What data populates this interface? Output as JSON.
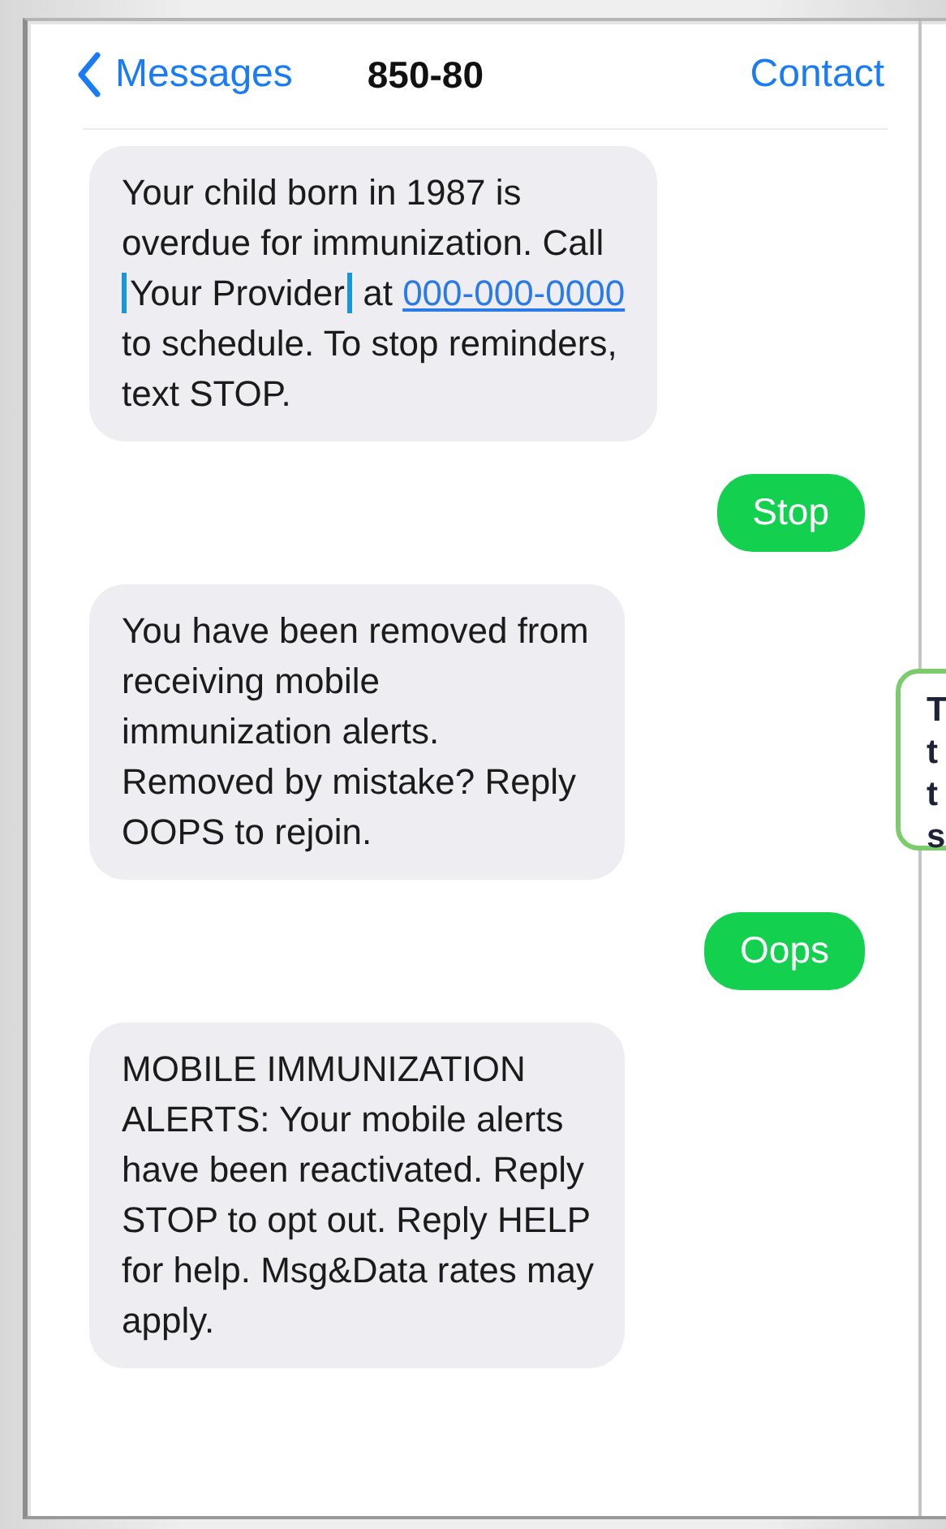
{
  "header": {
    "back_label": "Messages",
    "title": "850-80",
    "action": "Contact"
  },
  "messages": [
    {
      "kind": "incoming",
      "parts": [
        {
          "kind": "text",
          "text": "Your child born in 1987 is overdue for immunization. Call "
        },
        {
          "kind": "bracket",
          "text": "Your Provider"
        },
        {
          "kind": "text",
          "text": " at "
        },
        {
          "kind": "link",
          "text": "000-000-0000"
        },
        {
          "kind": "text",
          "text": " to schedule. To stop reminders, text STOP."
        }
      ]
    },
    {
      "kind": "outgoing",
      "parts": [
        {
          "kind": "text",
          "text": "Stop"
        }
      ]
    },
    {
      "kind": "incoming",
      "parts": [
        {
          "kind": "text",
          "text": "You have been removed from receiving mobile immunization alerts. Removed by mistake? Reply OOPS to rejoin."
        }
      ]
    },
    {
      "kind": "outgoing",
      "parts": [
        {
          "kind": "text",
          "text": "Oops"
        }
      ]
    },
    {
      "kind": "incoming",
      "parts": [
        {
          "kind": "text",
          "text": "MOBILE IMMUNIZATION ALERTS: Your mobile alerts have been reactivated. Reply STOP to opt out. Reply HELP for help. Msg&Data rates may apply."
        }
      ]
    }
  ],
  "callout": {
    "lines": [
      "T",
      "t",
      "t",
      "s"
    ]
  }
}
